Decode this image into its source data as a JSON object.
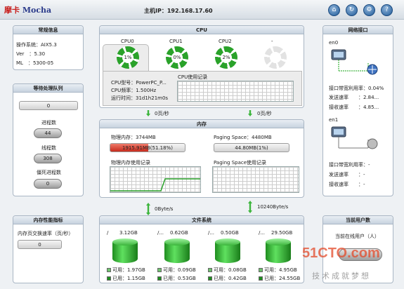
{
  "header": {
    "logo_text": "摩卡",
    "logo_brand": "Mocha",
    "host_ip_label": "主机IP：192.168.17.60"
  },
  "overview": {
    "title": "常规信息",
    "rows": [
      {
        "label": "操作系统",
        "value": "AIX5.3"
      },
      {
        "label": "Ver",
        "value": "5.30"
      },
      {
        "label": "ML",
        "value": "5300-05"
      }
    ]
  },
  "queue": {
    "title": "等待处理队列",
    "top_value": "0",
    "process_label": "进程数",
    "process_value": "44",
    "thread_label": "线程数",
    "thread_value": "308",
    "zombie_label": "僵死进程数",
    "zombie_value": "0"
  },
  "cpu": {
    "title": "CPU",
    "tabs": [
      {
        "name": "CPU0",
        "value": "1%",
        "active": true
      },
      {
        "name": "CPU1",
        "value": "0%",
        "active": false
      },
      {
        "name": "CPU2",
        "value": "2%",
        "active": false
      },
      {
        "name": "-",
        "value": "",
        "active": false
      }
    ],
    "model_label": "CPU型号：PowerPC_P...",
    "freq_label": "CPU频率：1.500Hz",
    "uptime_label": "运行时间：31d1h21m0s",
    "history_title": "CPU使用记录"
  },
  "io": {
    "page_in": "0页/秒",
    "page_out": "0页/秒",
    "byte_in": "0Byte/s",
    "byte_out": "10240Byte/s"
  },
  "memory": {
    "title": "内存",
    "physical_label": "物理内存：3744MB",
    "physical_used": "1915.91MB(51.18%)",
    "physical_used_fraction": 0.5118,
    "paging_label": "Paging Space：4480MB",
    "paging_used": "44.80MB(1%)",
    "physical_history_title": "物理内存使用记录",
    "paging_history_title": "Paging Space使用记录"
  },
  "network": {
    "title": "网络接口",
    "interfaces": [
      {
        "name": "en0",
        "util_label": "接口带宽利用率",
        "util_value": "0.04%",
        "send_label": "发送速率",
        "send_value": "2.84...",
        "recv_label": "接收速率",
        "recv_value": "4.85..."
      },
      {
        "name": "en1",
        "util_label": "接口带宽利用率",
        "util_value": "-",
        "send_label": "发送速率",
        "send_value": "-",
        "recv_label": "接收速率",
        "recv_value": "-"
      }
    ]
  },
  "memperf": {
    "title": "内存性能指标",
    "swap_label": "内存页交换速率（页/秒）",
    "swap_value": "0"
  },
  "filesystem": {
    "title": "文件系统",
    "free_label": "可用：",
    "used_label": "已用：",
    "items": [
      {
        "mount": "/",
        "total": "3.12GB",
        "free": "1.97GB",
        "used": "1.15GB"
      },
      {
        "mount": "/...",
        "total": "0.62GB",
        "free": "0.09GB",
        "used": "0.53GB"
      },
      {
        "mount": "/...",
        "total": "0.50GB",
        "free": "0.08GB",
        "used": "0.42GB"
      },
      {
        "mount": "/...",
        "total": "29.50GB",
        "free": "4.95GB",
        "used": "24.55GB"
      }
    ]
  },
  "users": {
    "title": "当前用户数",
    "current_label": "当前在线用户（人）",
    "current_value": ""
  },
  "watermark": {
    "site": "51CTO.com",
    "slogan": "技术成就梦想"
  },
  "colors": {
    "accent_green": "#2aa22a",
    "memory_bar": "#d23b2b",
    "header_bg": "#c7d3df"
  }
}
